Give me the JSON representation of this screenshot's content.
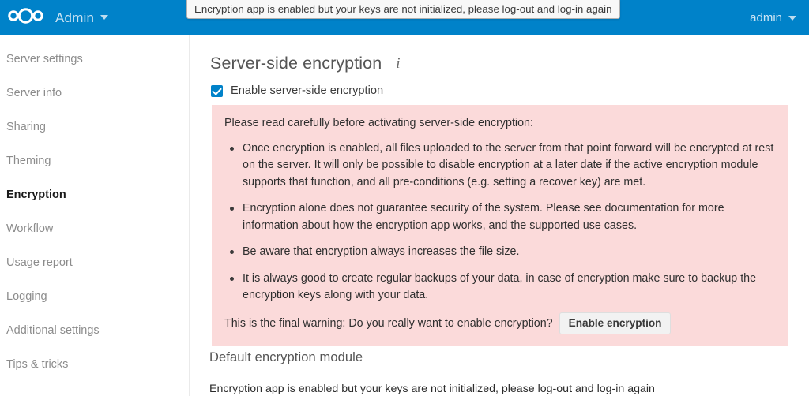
{
  "header": {
    "logo_icon": "nextcloud-logo-icon",
    "app_name": "Admin",
    "app_caret_icon": "chevron-down-icon",
    "user_name": "admin",
    "user_caret_icon": "chevron-down-icon",
    "brand_color": "#0082c9"
  },
  "notification": {
    "message": "Encryption app is enabled but your keys are not initialized, please log-out and log-in again"
  },
  "sidebar": {
    "items": [
      {
        "label": "Server settings",
        "active": false
      },
      {
        "label": "Server info",
        "active": false
      },
      {
        "label": "Sharing",
        "active": false
      },
      {
        "label": "Theming",
        "active": false
      },
      {
        "label": "Encryption",
        "active": true
      },
      {
        "label": "Workflow",
        "active": false
      },
      {
        "label": "Usage report",
        "active": false
      },
      {
        "label": "Logging",
        "active": false
      },
      {
        "label": "Additional settings",
        "active": false
      },
      {
        "label": "Tips & tricks",
        "active": false
      }
    ]
  },
  "main": {
    "page_title": "Server-side encryption",
    "info_icon": "info-icon",
    "info_glyph": "i",
    "enable_checkbox": {
      "label": "Enable server-side encryption",
      "checked": true
    },
    "warning": {
      "background_color": "#fbdada",
      "intro": "Please read carefully before activating server-side encryption:",
      "bullets": [
        "Once encryption is enabled, all files uploaded to the server from that point forward will be encrypted at rest on the server. It will only be possible to disable encryption at a later date if the active encryption module supports that function, and all pre-conditions (e.g. setting a recover key) are met.",
        "Encryption alone does not guarantee security of the system. Please see documentation for more information about how the encryption app works, and the supported use cases.",
        "Be aware that encryption always increases the file size.",
        "It is always good to create regular backups of your data, in case of encryption make sure to backup the encryption keys along with your data."
      ],
      "final_warning": "This is the final warning: Do you really want to enable encryption?",
      "enable_button_label": "Enable encryption"
    },
    "module_section": {
      "title": "Default encryption module",
      "status": "Encryption app is enabled but your keys are not initialized, please log-out and log-in again"
    }
  }
}
